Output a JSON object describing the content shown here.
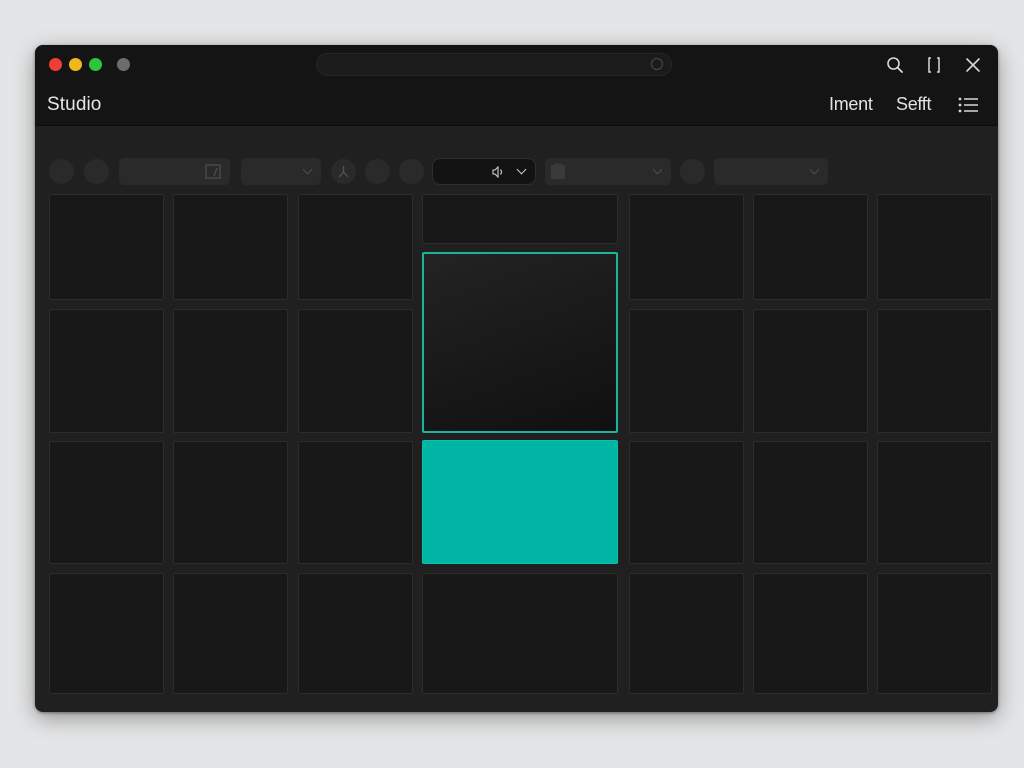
{
  "window": {
    "app_title": "Studio"
  },
  "header": {
    "links": [
      "Iment",
      "Sefft"
    ]
  },
  "icons": {
    "search": "search-icon",
    "maximize": "maximize-icon",
    "close": "close-icon",
    "menu": "list-menu-icon",
    "image": "image-icon",
    "wand": "wand-icon",
    "volume": "volume-icon",
    "document": "document-icon"
  },
  "colors": {
    "accent": "#00b5a3",
    "selected_border": "#19b3a0",
    "traffic_red": "#ee3e36",
    "traffic_yellow": "#f1b81d",
    "traffic_green": "#2cc53c"
  },
  "grid": {
    "rows": 4,
    "columns": 7,
    "selected_cell": "row 2, column 4",
    "accent_cell": "row 3, column 4"
  }
}
